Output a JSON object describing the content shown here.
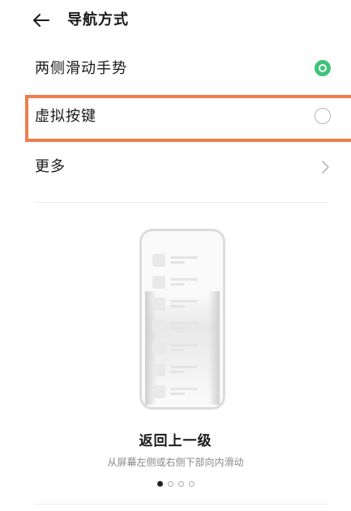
{
  "header": {
    "title": "导航方式",
    "back_icon": "arrow-left-icon"
  },
  "options": [
    {
      "label": "两侧滑动手势",
      "state": "selected",
      "color": "#3ec47a"
    },
    {
      "label": "虚拟按键",
      "state": "unselected",
      "highlight_color": "#ee7d4b"
    },
    {
      "label": "更多",
      "icon": "chevron-right-icon"
    }
  ],
  "preview": {
    "title": "返回上一级",
    "description": "从屏幕左侧或右侧下部向内滑动",
    "pager": {
      "total": 4,
      "active": 1
    }
  }
}
